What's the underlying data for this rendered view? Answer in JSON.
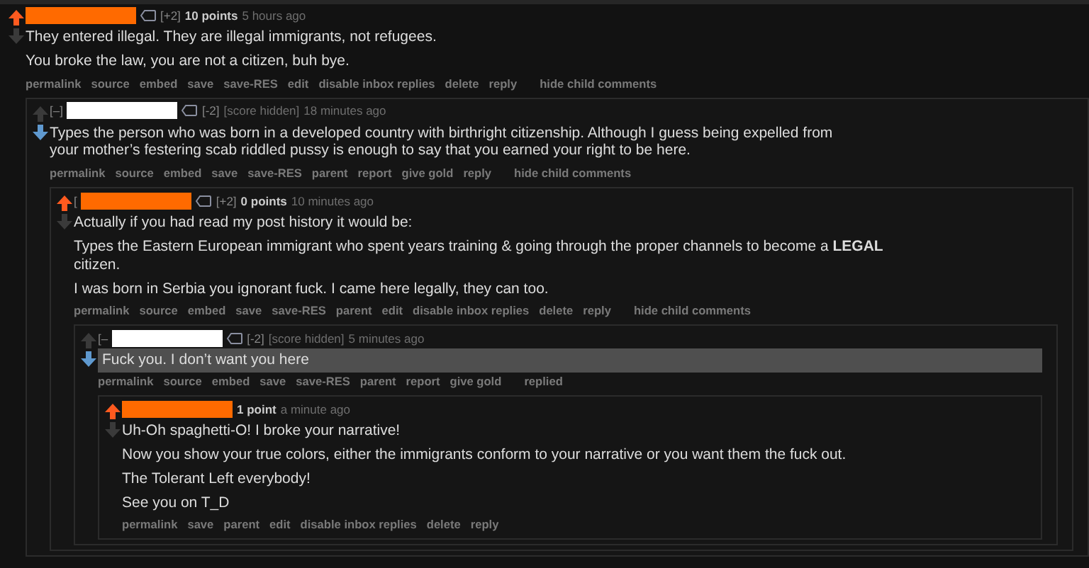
{
  "comments": [
    {
      "upvoted": true,
      "downvoted": false,
      "color": "#ff6a00",
      "vote_weight": "[+2]",
      "points": "10 points",
      "time": "5 hours ago",
      "highlighted": false,
      "paragraphs": [
        "They entered illegal. They are illegal immigrants, not refugees.",
        "You broke the law, you are not a citizen, buh bye."
      ],
      "actions": [
        "permalink",
        "source",
        "embed",
        "save",
        "save-RES",
        "edit",
        "disable inbox replies",
        "delete",
        "reply",
        "hide child comments"
      ],
      "children": [
        {
          "upvoted": false,
          "downvoted": true,
          "toggle": "[–]",
          "color": "#ffffff",
          "vote_weight": "[-2]",
          "score_note": "[score hidden]",
          "time": "18 minutes ago",
          "highlighted": false,
          "paragraphs": [
            "Types the person who was born in a developed country with birthright citizenship. Although I guess being expelled from your mother’s festering scab riddled pussy is enough to say that you earned your right to be here."
          ],
          "actions": [
            "permalink",
            "source",
            "embed",
            "save",
            "save-RES",
            "parent",
            "report",
            "give gold",
            "reply",
            "hide child comments"
          ],
          "children": [
            {
              "upvoted": true,
              "downvoted": false,
              "toggle": "[",
              "color": "#ff6a00",
              "vote_weight": "[+2]",
              "points": "0 points",
              "time": "10 minutes ago",
              "highlighted": false,
              "paragraphs": [
                "Actually if you had read my post history it would be:",
                "Types the Eastern European immigrant who spent years training & going through the proper channels to become a **LEGAL** citizen.",
                "I was born in Serbia you ignorant fuck. I came here legally, they can too."
              ],
              "actions": [
                "permalink",
                "source",
                "embed",
                "save",
                "save-RES",
                "parent",
                "edit",
                "disable inbox replies",
                "delete",
                "reply",
                "hide child comments"
              ],
              "children": [
                {
                  "upvoted": false,
                  "downvoted": true,
                  "toggle": "[–",
                  "color": "#ffffff",
                  "vote_weight": "[-2]",
                  "score_note": "[score hidden]",
                  "time": "5 minutes ago",
                  "highlighted": true,
                  "paragraphs": [
                    "Fuck you. I don’t want you here"
                  ],
                  "actions": [
                    "permalink",
                    "source",
                    "embed",
                    "save",
                    "save-RES",
                    "parent",
                    "report",
                    "give gold",
                    "replied"
                  ],
                  "children": [
                    {
                      "upvoted": true,
                      "downvoted": false,
                      "color": "#ff6a00",
                      "points": "1 point",
                      "time": "a minute ago",
                      "highlighted": false,
                      "paragraphs": [
                        "Uh-Oh spaghetti-O! I broke your narrative!",
                        "Now you show your true colors, either the immigrants conform to your narrative or you want them the fuck out.",
                        "The Tolerant Left everybody!",
                        "See you on T_D"
                      ],
                      "actions": [
                        "permalink",
                        "save",
                        "parent",
                        "edit",
                        "disable inbox replies",
                        "delete",
                        "reply"
                      ]
                    }
                  ]
                }
              ]
            }
          ]
        }
      ]
    }
  ]
}
